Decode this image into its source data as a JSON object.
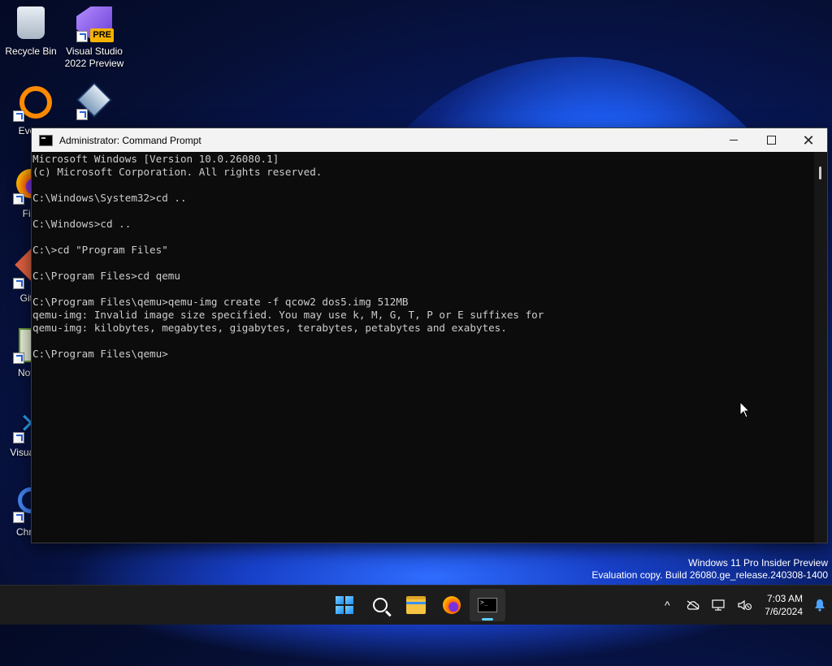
{
  "desktop": {
    "icons": [
      {
        "label": "Recycle Bin"
      },
      {
        "label": "Visual Studio 2022 Preview",
        "badge": "PRE"
      },
      {
        "label": "Every"
      },
      {
        "label": ""
      },
      {
        "label": "Fire"
      },
      {
        "label": "Git E"
      },
      {
        "label": "Notep"
      },
      {
        "label": "Visual Co"
      },
      {
        "label": "Chrom"
      }
    ]
  },
  "window": {
    "title": "Administrator: Command Prompt",
    "console_text": "Microsoft Windows [Version 10.0.26080.1]\n(c) Microsoft Corporation. All rights reserved.\n\nC:\\Windows\\System32>cd ..\n\nC:\\Windows>cd ..\n\nC:\\>cd \"Program Files\"\n\nC:\\Program Files>cd qemu\n\nC:\\Program Files\\qemu>qemu-img create -f qcow2 dos5.img 512MB\nqemu-img: Invalid image size specified. You may use k, M, G, T, P or E suffixes for\nqemu-img: kilobytes, megabytes, gigabytes, terabytes, petabytes and exabytes.\n\nC:\\Program Files\\qemu>"
  },
  "watermark": {
    "line1": "Windows 11 Pro Insider Preview",
    "line2": "Evaluation copy. Build 26080.ge_release.240308-1400"
  },
  "taskbar": {
    "time": "7:03 AM",
    "date": "7/6/2024",
    "chevron": "^"
  },
  "colors": {
    "accent": "#60cdff",
    "console_bg": "#0c0c0c",
    "console_fg": "#cccccc"
  }
}
